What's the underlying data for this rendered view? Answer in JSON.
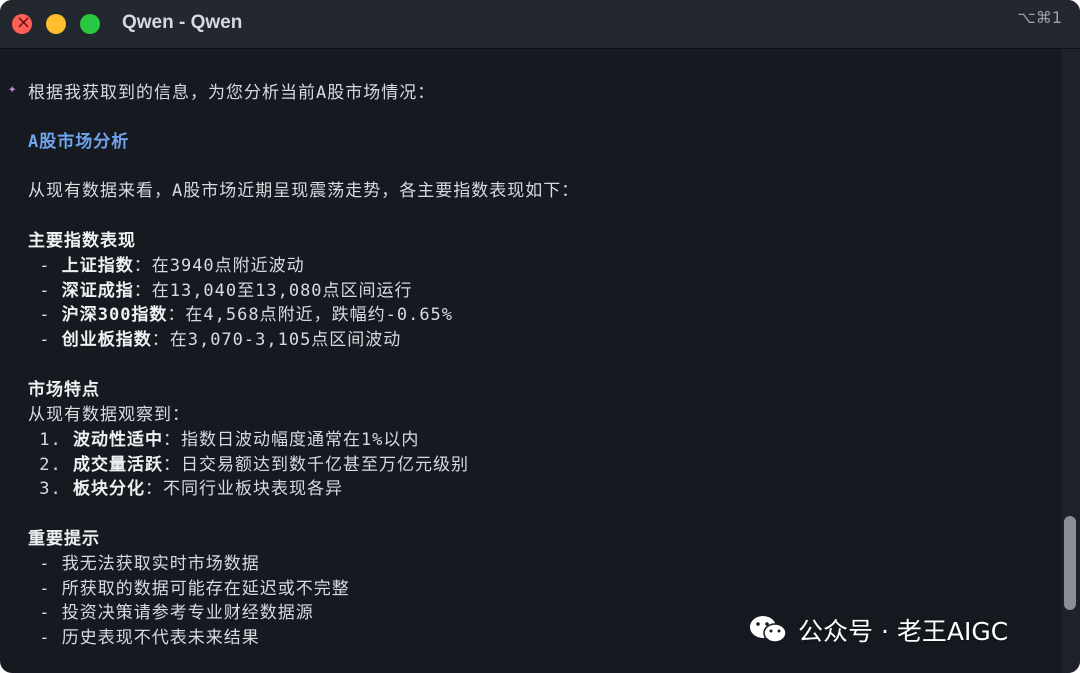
{
  "window": {
    "title": "Qwen - Qwen",
    "shortcut": "⌥⌘1"
  },
  "content": {
    "sparkle": "✦",
    "intro": "根据我获取到的信息，为您分析当前A股市场情况：",
    "heading": "A股市场分析",
    "summary": "从现有数据来看，A股市场近期呈现震荡走势，各主要指数表现如下：",
    "indices_title": "主要指数表现",
    "indices": [
      {
        "bullet": " - ",
        "name": "上证指数",
        "text": "：在3940点附近波动"
      },
      {
        "bullet": " - ",
        "name": "深证成指",
        "text": "：在13,040至13,080点区间运行"
      },
      {
        "bullet": " - ",
        "name": "沪深300指数",
        "text": "：在4,568点附近，跌幅约-0.65%"
      },
      {
        "bullet": " - ",
        "name": "创业板指数",
        "text": "：在3,070-3,105点区间波动"
      }
    ],
    "features_title": "市场特点",
    "features_intro": "从现有数据观察到：",
    "features": [
      {
        "num": " 1. ",
        "name": "波动性适中",
        "text": "：指数日波动幅度通常在1%以内"
      },
      {
        "num": " 2. ",
        "name": "成交量活跃",
        "text": "：日交易额达到数千亿甚至万亿元级别"
      },
      {
        "num": " 3. ",
        "name": "板块分化",
        "text": "：不同行业板块表现各异"
      }
    ],
    "notes_title": "重要提示",
    "notes": [
      " - 我无法获取实时市场数据",
      " - 所获取的数据可能存在延迟或不完整",
      " - 投资决策请参考专业财经数据源",
      " - 历史表现不代表未来结果"
    ]
  },
  "watermark": {
    "text": "公众号 · 老王AIGC",
    "icon": "wechat-icon"
  }
}
